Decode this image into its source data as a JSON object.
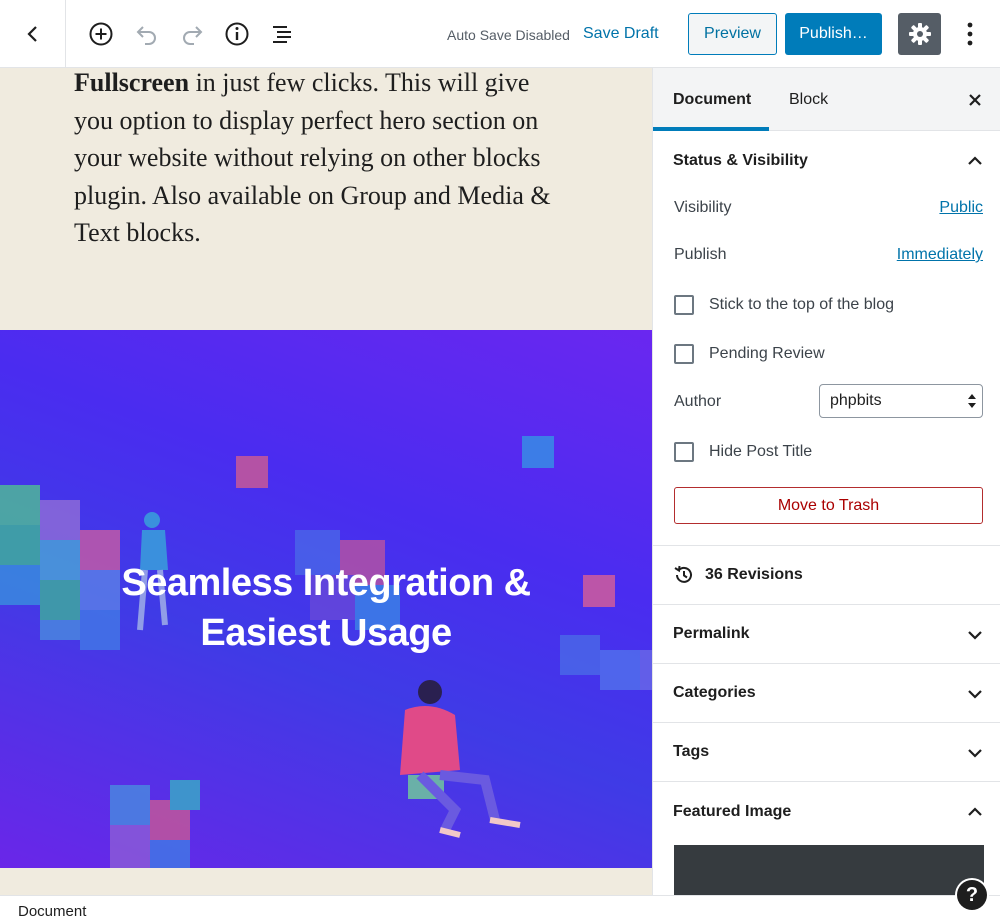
{
  "toolbar": {
    "autosave_text": "Auto Save Disabled",
    "save_draft_label": "Save Draft",
    "preview_label": "Preview",
    "publish_label": "Publish…",
    "icons": [
      "chevron-left-icon",
      "add-block-icon",
      "undo-icon",
      "redo-icon",
      "info-icon",
      "outline-icon",
      "gear-icon",
      "kebab-menu-icon"
    ]
  },
  "editor": {
    "paragraph_bold": "Fullscreen",
    "paragraph_rest": " in just few clicks. This will give you option to display perfect hero section on your website without relying on other blocks plugin. Also available on Group and Media & Text blocks.",
    "hero_line1": "Seamless Integration &",
    "hero_line2": "Easiest Usage",
    "hero_gradient": [
      "#6a27f0",
      "#3f3be6",
      "#6a26e8"
    ]
  },
  "sidebar": {
    "tab_document": "Document",
    "tab_block": "Block",
    "status_visibility": {
      "title": "Status & Visibility",
      "visibility_label": "Visibility",
      "visibility_value": "Public",
      "publish_label": "Publish",
      "publish_value": "Immediately",
      "stick_label": "Stick to the top of the blog",
      "pending_label": "Pending Review",
      "author_label": "Author",
      "author_value": "phpbits",
      "hide_title_label": "Hide Post Title",
      "trash_label": "Move to Trash"
    },
    "revisions_label": "36 Revisions",
    "panels": {
      "permalink": "Permalink",
      "categories": "Categories",
      "tags": "Tags",
      "featured_image": "Featured Image"
    }
  },
  "footer": {
    "breadcrumb": "Document",
    "help_glyph": "?"
  },
  "colors": {
    "accent": "#007cba",
    "link": "#0073aa",
    "danger": "#a00",
    "canvas_bg": "#f0ebdf"
  }
}
